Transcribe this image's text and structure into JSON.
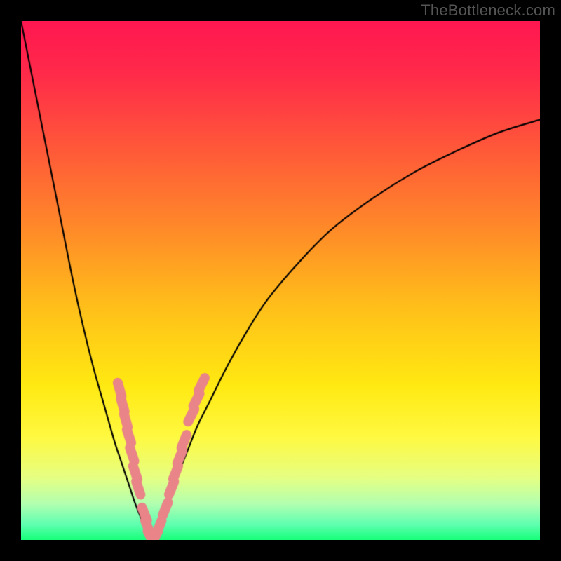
{
  "watermark": "TheBottleneck.com",
  "colors": {
    "frame": "#000000",
    "gradient_stops": [
      {
        "p": 0.0,
        "c": "#ff1751"
      },
      {
        "p": 0.1,
        "c": "#ff2a4a"
      },
      {
        "p": 0.25,
        "c": "#ff5a39"
      },
      {
        "p": 0.4,
        "c": "#ff8a29"
      },
      {
        "p": 0.55,
        "c": "#ffbf1a"
      },
      {
        "p": 0.7,
        "c": "#ffe912"
      },
      {
        "p": 0.8,
        "c": "#fff940"
      },
      {
        "p": 0.88,
        "c": "#e6ff83"
      },
      {
        "p": 0.93,
        "c": "#b3ffb0"
      },
      {
        "p": 0.97,
        "c": "#5fffb0"
      },
      {
        "p": 1.0,
        "c": "#17ff7a"
      }
    ],
    "curve": "#000000",
    "markers": "#e98488"
  },
  "chart_data": {
    "type": "line",
    "title": "",
    "xlabel": "",
    "ylabel": "",
    "xlim": [
      0,
      100
    ],
    "ylim": [
      0,
      100
    ],
    "series": [
      {
        "name": "left-branch",
        "x": [
          0,
          2,
          4,
          6,
          8,
          10,
          12,
          14,
          16,
          18,
          19,
          20,
          21,
          22,
          23,
          24,
          25
        ],
        "y": [
          100,
          90,
          80,
          70,
          60,
          50,
          41,
          33,
          26,
          19,
          16,
          13,
          10,
          7,
          4.5,
          2,
          0
        ]
      },
      {
        "name": "right-branch",
        "x": [
          25,
          26,
          27,
          28,
          30,
          32,
          34,
          36,
          40,
          44,
          48,
          54,
          60,
          68,
          76,
          84,
          92,
          100
        ],
        "y": [
          0,
          2,
          4.5,
          7,
          12,
          17,
          22,
          26,
          34,
          41,
          47,
          54,
          60,
          66,
          71,
          75,
          78.5,
          81
        ]
      }
    ],
    "markers": [
      {
        "x": 19.0,
        "y": 29.0
      },
      {
        "x": 19.6,
        "y": 26.0
      },
      {
        "x": 20.2,
        "y": 23.0
      },
      {
        "x": 20.8,
        "y": 20.0
      },
      {
        "x": 21.4,
        "y": 16.5
      },
      {
        "x": 22.0,
        "y": 13.0
      },
      {
        "x": 22.6,
        "y": 10.0
      },
      {
        "x": 23.8,
        "y": 5.0
      },
      {
        "x": 24.4,
        "y": 2.5
      },
      {
        "x": 25.0,
        "y": 0.5
      },
      {
        "x": 25.8,
        "y": 0.5
      },
      {
        "x": 26.6,
        "y": 2.5
      },
      {
        "x": 27.8,
        "y": 6.0
      },
      {
        "x": 29.0,
        "y": 10.0
      },
      {
        "x": 29.8,
        "y": 13.0
      },
      {
        "x": 30.6,
        "y": 16.0
      },
      {
        "x": 31.4,
        "y": 19.0
      },
      {
        "x": 32.8,
        "y": 24.0
      },
      {
        "x": 33.8,
        "y": 27.0
      },
      {
        "x": 34.8,
        "y": 30.0
      }
    ]
  }
}
